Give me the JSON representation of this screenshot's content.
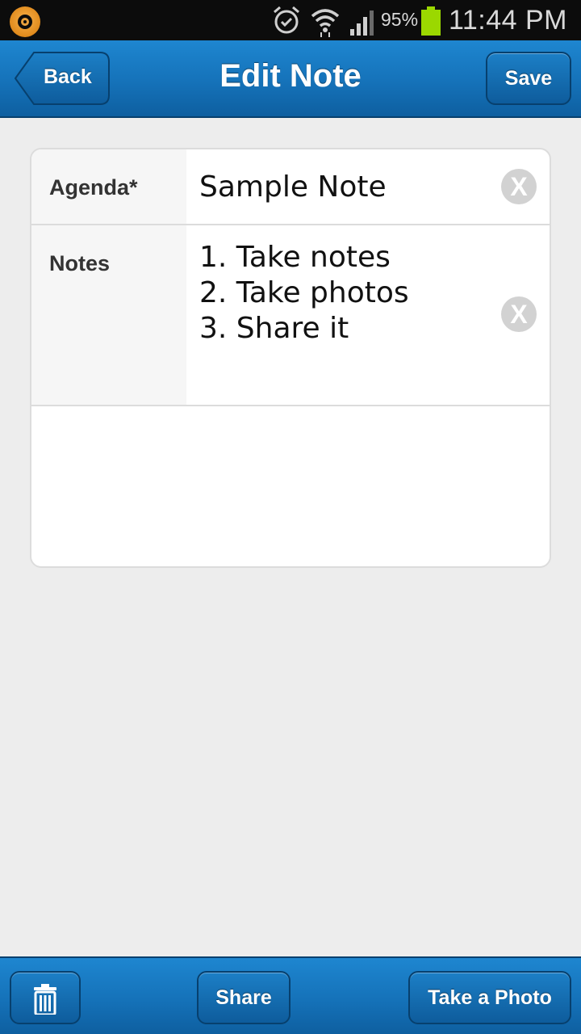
{
  "status_bar": {
    "battery_percent": "95%",
    "time": "11:44 PM",
    "icons": [
      "app-notification-icon",
      "alarm-icon",
      "wifi-icon",
      "signal-icon",
      "battery-icon"
    ],
    "battery_level": 0.95,
    "battery_color": "#9bd800"
  },
  "header": {
    "title": "Edit Note",
    "back_label": "Back",
    "save_label": "Save"
  },
  "form": {
    "agenda_label": "Agenda*",
    "agenda_value": "Sample Note",
    "notes_label": "Notes",
    "notes_lines": [
      "1. Take notes",
      "2. Take photos",
      "3. Share it"
    ],
    "clear_glyph": "X"
  },
  "toolbar": {
    "delete_icon": "trash-icon",
    "share_label": "Share",
    "photo_label": "Take a Photo"
  },
  "colors": {
    "header_blue": "#1572b9",
    "button_border": "#07406e",
    "background": "#ededed"
  }
}
